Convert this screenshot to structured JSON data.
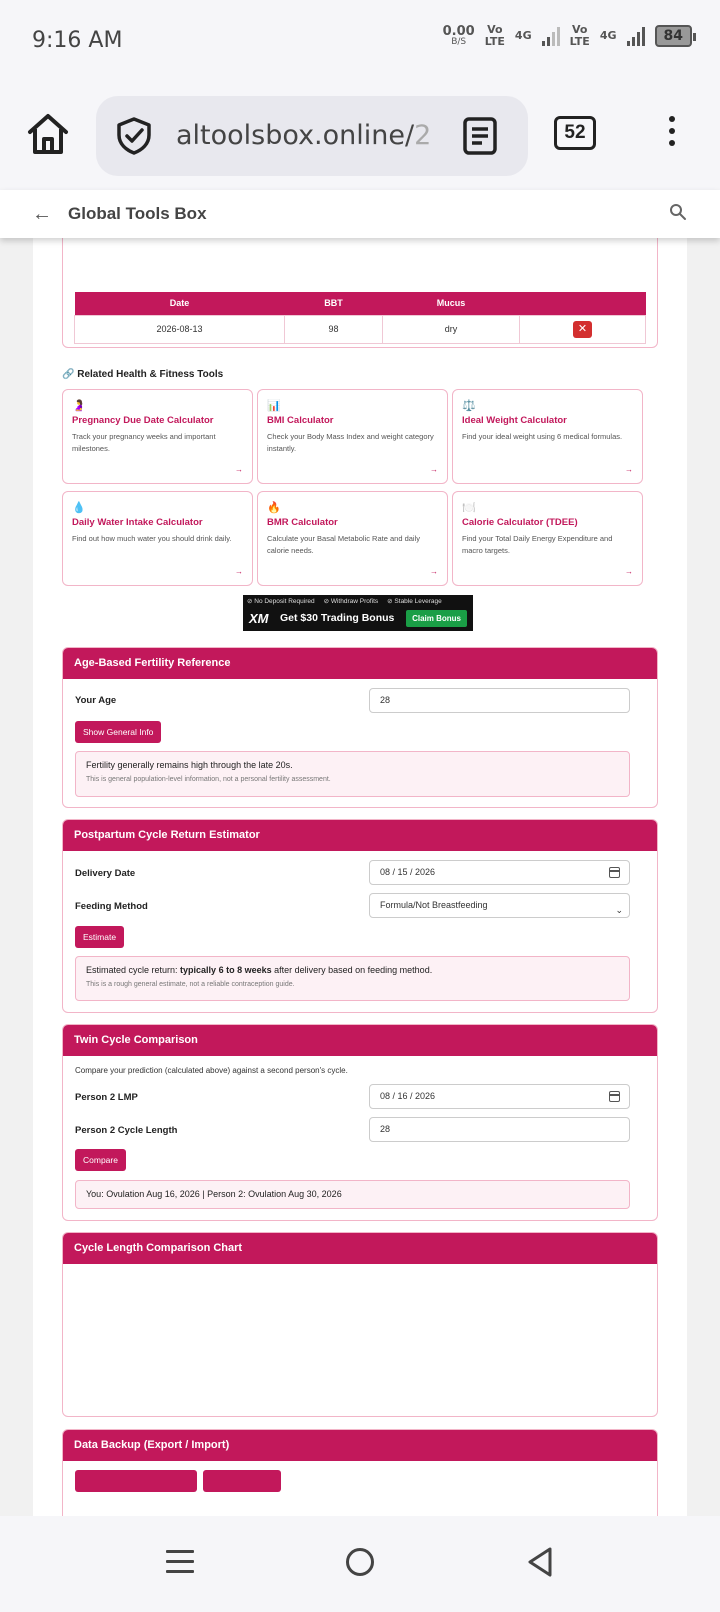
{
  "status_bar": {
    "time": "9:16 AM",
    "speed_value": "0.00",
    "speed_unit": "B/S",
    "net1_a": "Vo",
    "net1_b": "LTE",
    "net1_gen": "4G",
    "net2_a": "Vo",
    "net2_b": "LTE",
    "net2_gen": "4G",
    "battery": "84"
  },
  "browser": {
    "url_visible": "altoolsbox.online/",
    "url_fade": "2",
    "tab_count": "52",
    "icons": [
      "home-icon",
      "shield-check-icon",
      "reader-mode-icon",
      "more-vert-icon"
    ]
  },
  "site_header": {
    "back_glyph": "←",
    "title": "Global Tools Box"
  },
  "log_table": {
    "headers": [
      "Date",
      "BBT",
      "Mucus",
      ""
    ],
    "rows": [
      {
        "date": "2026-08-13",
        "bbt": "98",
        "mucus": "dry",
        "delete_glyph": "✕"
      }
    ]
  },
  "related": {
    "title": "🔗 Related Health & Fitness Tools",
    "tools": [
      {
        "icon": "🤰",
        "name": "Pregnancy Due Date Calculator",
        "desc": "Track your pregnancy weeks and important milestones.",
        "arrow": "→"
      },
      {
        "icon": "📊",
        "name": "BMI Calculator",
        "desc": "Check your Body Mass Index and weight category instantly.",
        "arrow": "→"
      },
      {
        "icon": "⚖️",
        "name": "Ideal Weight Calculator",
        "desc": "Find your ideal weight using 6 medical formulas.",
        "arrow": "→"
      },
      {
        "icon": "💧",
        "name": "Daily Water Intake Calculator",
        "desc": "Find out how much water you should drink daily.",
        "arrow": "→"
      },
      {
        "icon": "🔥",
        "name": "BMR Calculator",
        "desc": "Calculate your Basal Metabolic Rate and daily calorie needs.",
        "arrow": "→"
      },
      {
        "icon": "🍽️",
        "name": "Calorie Calculator (TDEE)",
        "desc": "Find your Total Daily Energy Expenditure and macro targets.",
        "arrow": "→"
      }
    ]
  },
  "ad": {
    "badges": [
      "⊘ No Deposit Required",
      "⊘ Withdraw Profits",
      "⊘ Stable Leverage"
    ],
    "logo": "XM",
    "text": "Get $30 Trading Bonus",
    "button": "Claim Bonus"
  },
  "age_section": {
    "title": "Age-Based Fertility Reference",
    "age_label": "Your Age",
    "age_value": "28",
    "button": "Show General Info",
    "result": "Fertility generally remains high through the late 20s.",
    "note": "This is general population-level information, not a personal fertility assessment."
  },
  "postpartum_section": {
    "title": "Postpartum Cycle Return Estimator",
    "delivery_label": "Delivery Date",
    "delivery_value": "08 / 15 / 2026",
    "feeding_label": "Feeding Method",
    "feeding_value": "Formula/Not Breastfeeding",
    "button": "Estimate",
    "result_prefix": "Estimated cycle return: ",
    "result_bold": "typically 6 to 8 weeks",
    "result_suffix": " after delivery based on feeding method.",
    "note": "This is a rough general estimate, not a reliable contraception guide."
  },
  "twin_section": {
    "title": "Twin Cycle Comparison",
    "intro": "Compare your prediction (calculated above) against a second person's cycle.",
    "lmp_label": "Person 2 LMP",
    "lmp_value": "08 / 16 / 2026",
    "length_label": "Person 2 Cycle Length",
    "length_value": "28",
    "button": "Compare",
    "result": "You: Ovulation Aug 16, 2026 | Person 2: Ovulation Aug 30, 2026"
  },
  "chart_section": {
    "title": "Cycle Length Comparison Chart"
  },
  "backup_section": {
    "title": "Data Backup (Export / Import)"
  },
  "colors": {
    "accent": "#c2185b",
    "accent_border": "#f2b5c8",
    "result_bg": "#fdf1f5"
  }
}
